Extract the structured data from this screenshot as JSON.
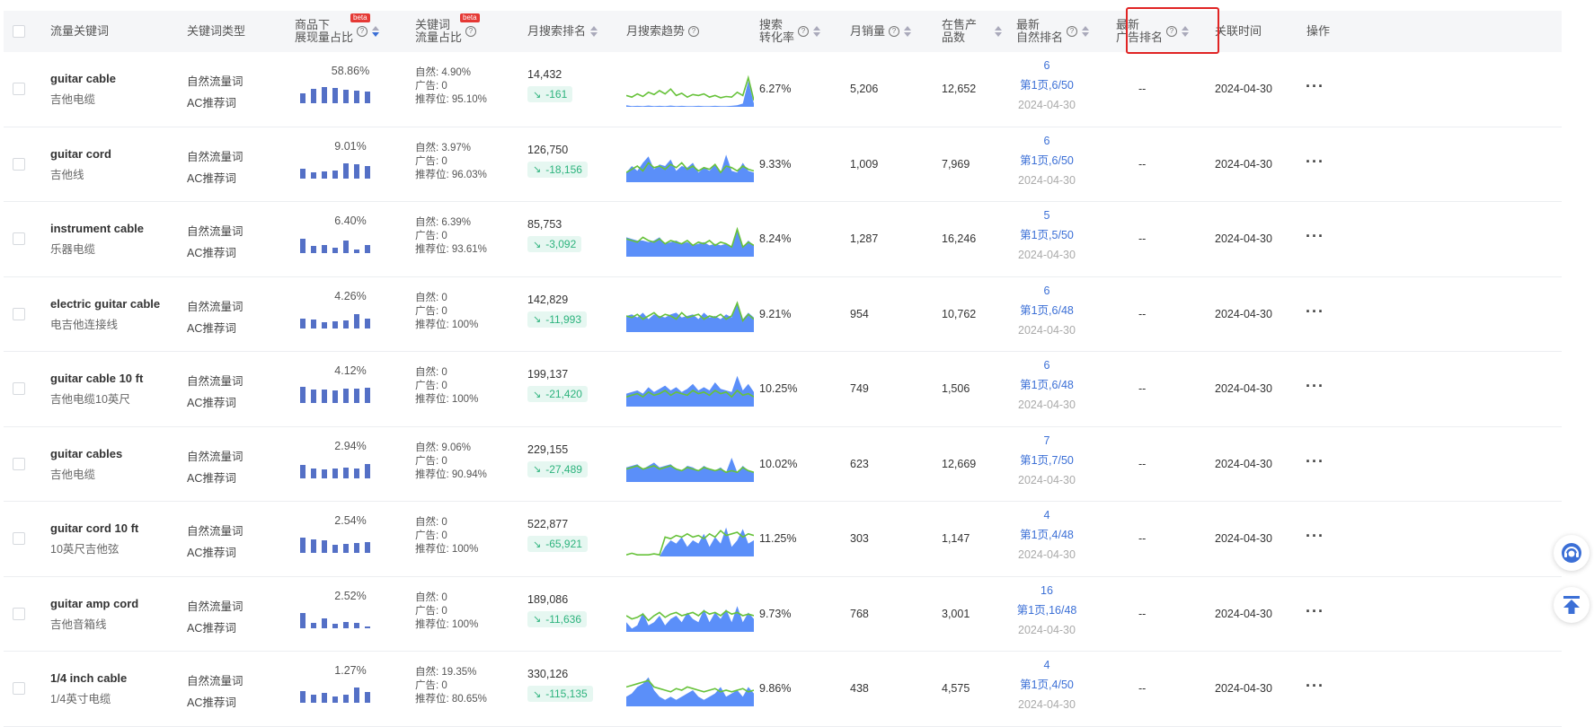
{
  "headers": {
    "keyword": "流量关键词",
    "keyword_type": "关键词类型",
    "display_share_l1": "商品下",
    "display_share_l2": "展现量占比",
    "display_share_beta": "beta",
    "traffic_share_l1": "关键词",
    "traffic_share_l2": "流量占比",
    "traffic_share_beta": "beta",
    "monthly_rank": "月搜索排名",
    "monthly_trend": "月搜索趋势",
    "conversion_l1": "搜索",
    "conversion_l2": "转化率",
    "monthly_sales": "月销量",
    "on_sale_l1": "在售产",
    "on_sale_l2": "品数",
    "latest_organic_l1": "最新",
    "latest_organic_l2": "自然排名",
    "latest_ad_l1": "最新",
    "latest_ad_l2": "广告排名",
    "link_time": "关联时间",
    "operations": "操作",
    "help_glyph": "?"
  },
  "labels": {
    "natural_prefix": "自然: ",
    "ad_prefix": "广告: ",
    "rec_prefix": "推荐位: ",
    "trend_arrow": "↘",
    "ops_glyph": "···"
  },
  "rows": [
    {
      "kw_en": "guitar cable",
      "kw_cn": "吉他电缆",
      "type1": "自然流量词",
      "type2": "AC推荐词",
      "display_pct": "58.86%",
      "bars": [
        0.55,
        0.8,
        0.9,
        0.85,
        0.75,
        0.7,
        0.65
      ],
      "natural": "4.90%",
      "ad": "0",
      "rec": "95.10%",
      "rank": "14,432",
      "rank_change": "-161",
      "conversion": "6.27%",
      "sales": "5,206",
      "on_sale": "12,652",
      "rank_top": "6",
      "rank_page": "第1页,6/50",
      "rank_date": "2024-04-30",
      "ad_rank": "--",
      "link_time": "2024-04-30",
      "spark": [
        0.35,
        0.3,
        0.4,
        0.32,
        0.45,
        0.38,
        0.5,
        0.4,
        0.55,
        0.35,
        0.42,
        0.3,
        0.38,
        0.35,
        0.4,
        0.3,
        0.35,
        0.28,
        0.32,
        0.3,
        0.45,
        0.35,
        0.9,
        0.2
      ],
      "spark_area": [
        0.05,
        0.02,
        0.03,
        0.02,
        0.04,
        0.02,
        0.03,
        0.02,
        0.04,
        0.02,
        0.03,
        0.02,
        0.02,
        0.03,
        0.02,
        0.02,
        0.03,
        0.02,
        0.02,
        0.03,
        0.05,
        0.1,
        0.8,
        0.1
      ]
    },
    {
      "kw_en": "guitar cord",
      "kw_cn": "吉他线",
      "type1": "自然流量词",
      "type2": "AC推荐词",
      "display_pct": "9.01%",
      "bars": [
        0.55,
        0.35,
        0.4,
        0.45,
        0.85,
        0.8,
        0.7
      ],
      "natural": "3.97%",
      "ad": "0",
      "rec": "96.03%",
      "rank": "126,750",
      "rank_change": "-18,156",
      "conversion": "9.33%",
      "sales": "1,009",
      "on_sale": "7,969",
      "rank_top": "6",
      "rank_page": "第1页,6/50",
      "rank_date": "2024-04-30",
      "ad_rank": "--",
      "link_time": "2024-04-30",
      "spark": [
        0.3,
        0.4,
        0.5,
        0.35,
        0.6,
        0.45,
        0.5,
        0.4,
        0.55,
        0.45,
        0.6,
        0.4,
        0.5,
        0.35,
        0.45,
        0.4,
        0.55,
        0.3,
        0.5,
        0.45,
        0.35,
        0.5,
        0.4,
        0.35
      ],
      "spark_area": [
        0.3,
        0.5,
        0.35,
        0.6,
        0.8,
        0.4,
        0.55,
        0.5,
        0.7,
        0.35,
        0.5,
        0.45,
        0.6,
        0.3,
        0.45,
        0.35,
        0.55,
        0.3,
        0.85,
        0.35,
        0.3,
        0.6,
        0.35,
        0.3
      ]
    },
    {
      "kw_en": "instrument cable",
      "kw_cn": "乐器电缆",
      "type1": "自然流量词",
      "type2": "AC推荐词",
      "display_pct": "6.40%",
      "bars": [
        0.8,
        0.4,
        0.45,
        0.3,
        0.7,
        0.2,
        0.45
      ],
      "natural": "6.39%",
      "ad": "0",
      "rec": "93.61%",
      "rank": "85,753",
      "rank_change": "-3,092",
      "conversion": "8.24%",
      "sales": "1,287",
      "on_sale": "16,246",
      "rank_top": "5",
      "rank_page": "第1页,5/50",
      "rank_date": "2024-04-30",
      "ad_rank": "--",
      "link_time": "2024-04-30",
      "spark": [
        0.55,
        0.5,
        0.45,
        0.6,
        0.5,
        0.45,
        0.55,
        0.4,
        0.5,
        0.45,
        0.4,
        0.5,
        0.35,
        0.45,
        0.4,
        0.5,
        0.35,
        0.45,
        0.4,
        0.3,
        0.85,
        0.3,
        0.45,
        0.35
      ],
      "spark_area": [
        0.6,
        0.55,
        0.5,
        0.5,
        0.45,
        0.5,
        0.6,
        0.4,
        0.45,
        0.5,
        0.4,
        0.45,
        0.35,
        0.4,
        0.45,
        0.35,
        0.4,
        0.35,
        0.4,
        0.3,
        0.9,
        0.3,
        0.5,
        0.35
      ]
    },
    {
      "kw_en": "electric guitar cable",
      "kw_cn": "电吉他连接线",
      "type1": "自然流量词",
      "type2": "AC推荐词",
      "display_pct": "4.26%",
      "bars": [
        0.55,
        0.5,
        0.35,
        0.4,
        0.45,
        0.8,
        0.55
      ],
      "natural": "0",
      "ad": "0",
      "rec": "100%",
      "rank": "142,829",
      "rank_change": "-11,993",
      "conversion": "9.21%",
      "sales": "954",
      "on_sale": "10,762",
      "rank_top": "6",
      "rank_page": "第1页,6/48",
      "rank_date": "2024-04-30",
      "ad_rank": "--",
      "link_time": "2024-04-30",
      "spark": [
        0.5,
        0.45,
        0.55,
        0.4,
        0.5,
        0.6,
        0.45,
        0.55,
        0.5,
        0.4,
        0.6,
        0.45,
        0.5,
        0.55,
        0.4,
        0.5,
        0.45,
        0.55,
        0.4,
        0.5,
        0.9,
        0.35,
        0.55,
        0.4
      ],
      "spark_area": [
        0.5,
        0.55,
        0.45,
        0.6,
        0.4,
        0.55,
        0.5,
        0.45,
        0.55,
        0.6,
        0.45,
        0.5,
        0.55,
        0.4,
        0.6,
        0.45,
        0.5,
        0.4,
        0.55,
        0.45,
        0.95,
        0.4,
        0.6,
        0.45
      ]
    },
    {
      "kw_en": "guitar cable 10 ft",
      "kw_cn": "吉他电缆10英尺",
      "type1": "自然流量词",
      "type2": "AC推荐词",
      "display_pct": "4.12%",
      "bars": [
        0.9,
        0.75,
        0.75,
        0.7,
        0.8,
        0.8,
        0.85
      ],
      "natural": "0",
      "ad": "0",
      "rec": "100%",
      "rank": "199,137",
      "rank_change": "-21,420",
      "conversion": "10.25%",
      "sales": "749",
      "on_sale": "1,506",
      "rank_top": "6",
      "rank_page": "第1页,6/48",
      "rank_date": "2024-04-30",
      "ad_rank": "--",
      "link_time": "2024-04-30",
      "spark": [
        0.3,
        0.35,
        0.4,
        0.3,
        0.45,
        0.35,
        0.4,
        0.5,
        0.35,
        0.45,
        0.4,
        0.35,
        0.5,
        0.4,
        0.45,
        0.35,
        0.5,
        0.4,
        0.45,
        0.3,
        0.5,
        0.35,
        0.4,
        0.3
      ],
      "spark_area": [
        0.4,
        0.45,
        0.5,
        0.4,
        0.6,
        0.45,
        0.55,
        0.65,
        0.5,
        0.6,
        0.45,
        0.55,
        0.7,
        0.5,
        0.6,
        0.5,
        0.75,
        0.55,
        0.5,
        0.45,
        0.95,
        0.5,
        0.7,
        0.45
      ]
    },
    {
      "kw_en": "guitar cables",
      "kw_cn": "吉他电缆",
      "type1": "自然流量词",
      "type2": "AC推荐词",
      "display_pct": "2.94%",
      "bars": [
        0.75,
        0.55,
        0.5,
        0.55,
        0.6,
        0.55,
        0.8
      ],
      "natural": "9.06%",
      "ad": "0",
      "rec": "90.94%",
      "rank": "229,155",
      "rank_change": "-27,489",
      "conversion": "10.02%",
      "sales": "623",
      "on_sale": "12,669",
      "rank_top": "7",
      "rank_page": "第1页,7/50",
      "rank_date": "2024-04-30",
      "ad_rank": "--",
      "link_time": "2024-04-30",
      "spark": [
        0.4,
        0.45,
        0.5,
        0.4,
        0.45,
        0.5,
        0.4,
        0.45,
        0.5,
        0.4,
        0.35,
        0.45,
        0.4,
        0.35,
        0.45,
        0.4,
        0.35,
        0.4,
        0.3,
        0.35,
        0.3,
        0.45,
        0.35,
        0.3
      ],
      "spark_area": [
        0.45,
        0.5,
        0.55,
        0.4,
        0.5,
        0.6,
        0.45,
        0.5,
        0.55,
        0.4,
        0.35,
        0.5,
        0.45,
        0.35,
        0.5,
        0.4,
        0.35,
        0.45,
        0.3,
        0.75,
        0.3,
        0.5,
        0.35,
        0.3
      ]
    },
    {
      "kw_en": "guitar cord 10 ft",
      "kw_cn": "10英尺吉他弦",
      "type1": "自然流量词",
      "type2": "AC推荐词",
      "display_pct": "2.54%",
      "bars": [
        0.85,
        0.75,
        0.7,
        0.45,
        0.5,
        0.55,
        0.6
      ],
      "natural": "0",
      "ad": "0",
      "rec": "100%",
      "rank": "522,877",
      "rank_change": "-65,921",
      "conversion": "11.25%",
      "sales": "303",
      "on_sale": "1,147",
      "rank_top": "4",
      "rank_page": "第1页,4/48",
      "rank_date": "2024-04-30",
      "ad_rank": "--",
      "link_time": "2024-04-30",
      "spark": [
        0.05,
        0.1,
        0.05,
        0.05,
        0.05,
        0.08,
        0.05,
        0.6,
        0.55,
        0.65,
        0.6,
        0.7,
        0.6,
        0.65,
        0.55,
        0.7,
        0.6,
        0.8,
        0.65,
        0.7,
        0.75,
        0.6,
        0.7,
        0.65
      ],
      "spark_area": [
        0,
        0,
        0,
        0,
        0,
        0,
        0,
        0.3,
        0.5,
        0.4,
        0.6,
        0.3,
        0.5,
        0.4,
        0.7,
        0.3,
        0.6,
        0.4,
        0.9,
        0.3,
        0.5,
        0.85,
        0.4,
        0.5
      ]
    },
    {
      "kw_en": "guitar amp cord",
      "kw_cn": "吉他音箱线",
      "type1": "自然流量词",
      "type2": "AC推荐词",
      "display_pct": "2.52%",
      "bars": [
        0.85,
        0.3,
        0.55,
        0.25,
        0.35,
        0.3,
        0.1
      ],
      "natural": "0",
      "ad": "0",
      "rec": "100%",
      "rank": "189,086",
      "rank_change": "-11,636",
      "conversion": "9.73%",
      "sales": "768",
      "on_sale": "3,001",
      "rank_top": "16",
      "rank_page": "第1页,16/48",
      "rank_date": "2024-04-30",
      "ad_rank": "--",
      "link_time": "2024-04-30",
      "spark": [
        0.5,
        0.4,
        0.45,
        0.55,
        0.35,
        0.5,
        0.6,
        0.45,
        0.55,
        0.6,
        0.5,
        0.55,
        0.6,
        0.5,
        0.65,
        0.55,
        0.6,
        0.5,
        0.65,
        0.55,
        0.6,
        0.5,
        0.55,
        0.5
      ],
      "spark_area": [
        0.3,
        0.1,
        0.2,
        0.6,
        0.2,
        0.3,
        0.5,
        0.2,
        0.4,
        0.5,
        0.3,
        0.6,
        0.4,
        0.3,
        0.7,
        0.3,
        0.6,
        0.4,
        0.7,
        0.3,
        0.8,
        0.3,
        0.6,
        0.4
      ]
    },
    {
      "kw_en": "1/4 inch cable",
      "kw_cn": "1/4英寸电缆",
      "type1": "自然流量词",
      "type2": "AC推荐词",
      "display_pct": "1.27%",
      "bars": [
        0.65,
        0.45,
        0.55,
        0.35,
        0.45,
        0.85,
        0.6
      ],
      "natural": "19.35%",
      "ad": "0",
      "rec": "80.65%",
      "rank": "330,126",
      "rank_change": "-115,135",
      "conversion": "9.86%",
      "sales": "438",
      "on_sale": "4,575",
      "rank_top": "4",
      "rank_page": "第1页,4/50",
      "rank_date": "2024-04-30",
      "ad_rank": "--",
      "link_time": "2024-04-30",
      "spark": [
        0.6,
        0.65,
        0.7,
        0.75,
        0.8,
        0.6,
        0.55,
        0.5,
        0.45,
        0.55,
        0.5,
        0.6,
        0.55,
        0.5,
        0.45,
        0.5,
        0.55,
        0.45,
        0.5,
        0.45,
        0.5,
        0.55,
        0.45,
        0.5
      ],
      "spark_area": [
        0.3,
        0.4,
        0.6,
        0.7,
        0.9,
        0.5,
        0.3,
        0.2,
        0.3,
        0.2,
        0.3,
        0.4,
        0.5,
        0.3,
        0.2,
        0.3,
        0.4,
        0.6,
        0.3,
        0.4,
        0.5,
        0.3,
        0.6,
        0.4
      ]
    }
  ],
  "colors": {
    "accent": "#3b6fd6",
    "bar": "#5470c6",
    "spark_line": "#67c23a",
    "spark_area": "#5b8ff9",
    "highlight": "#e02424",
    "trend_bg": "#e6f7f1",
    "trend_text": "#2db37d"
  }
}
